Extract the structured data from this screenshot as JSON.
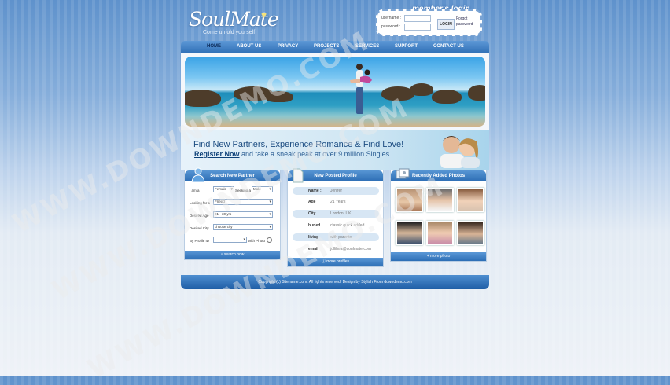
{
  "logo": {
    "name": "SoulMate",
    "tagline": "Come unfold yourself"
  },
  "login": {
    "title": "member's login",
    "username_label": "username :",
    "password_label": "password :",
    "button": "LOGIN",
    "forgot": "Forgot password"
  },
  "nav": [
    "HOME",
    "ABOUT US",
    "PRIVACY",
    "PROJECTS",
    "SERVICES",
    "SUPPORT",
    "CONTACT US"
  ],
  "promo": {
    "headline": "Find New Partners, Experience Romance & Find Love!",
    "register": "Register Now",
    "rest": "and take a sneak peak at over 9 million Singles."
  },
  "search": {
    "title": "Search New Partner",
    "fields": [
      {
        "label": "I am a",
        "values": [
          "Female",
          "Male"
        ],
        "mid": "Seeking a"
      },
      {
        "label": "Looking for a",
        "values": [
          "Friend"
        ]
      },
      {
        "label": "Desired Age",
        "values": [
          "21 - 30 yrs"
        ]
      },
      {
        "label": "Desired City",
        "values": [
          "choose city"
        ]
      },
      {
        "label": "By Profile ID",
        "values": [
          ""
        ],
        "extra": "With Photo"
      }
    ],
    "button": "search now"
  },
  "profile": {
    "title": "New Posted Profile",
    "rows": [
      {
        "k": "Name :",
        "v": "Jenifer"
      },
      {
        "k": "Age",
        "v": "21 Years"
      },
      {
        "k": "City",
        "v": "London, UK"
      },
      {
        "k": "buried",
        "v": "classic quick added"
      },
      {
        "k": "living",
        "v": "with parents"
      },
      {
        "k": "email",
        "v": "jollibea@soulmate.com"
      }
    ],
    "more": "more profiles"
  },
  "photos": {
    "title": "Recently Added Photos",
    "more": "more photo"
  },
  "footer": {
    "copyright": "Copyright (c) Sitename.com. All rights reserved. Design by",
    "designer": "Stylish From",
    "link": "downdemo.com"
  },
  "watermark": "WWW.DOWNDEMO.COM",
  "colors": {
    "nav": "#2f6fb6",
    "accent": "#1d4d82",
    "background": "#8fb4df"
  }
}
